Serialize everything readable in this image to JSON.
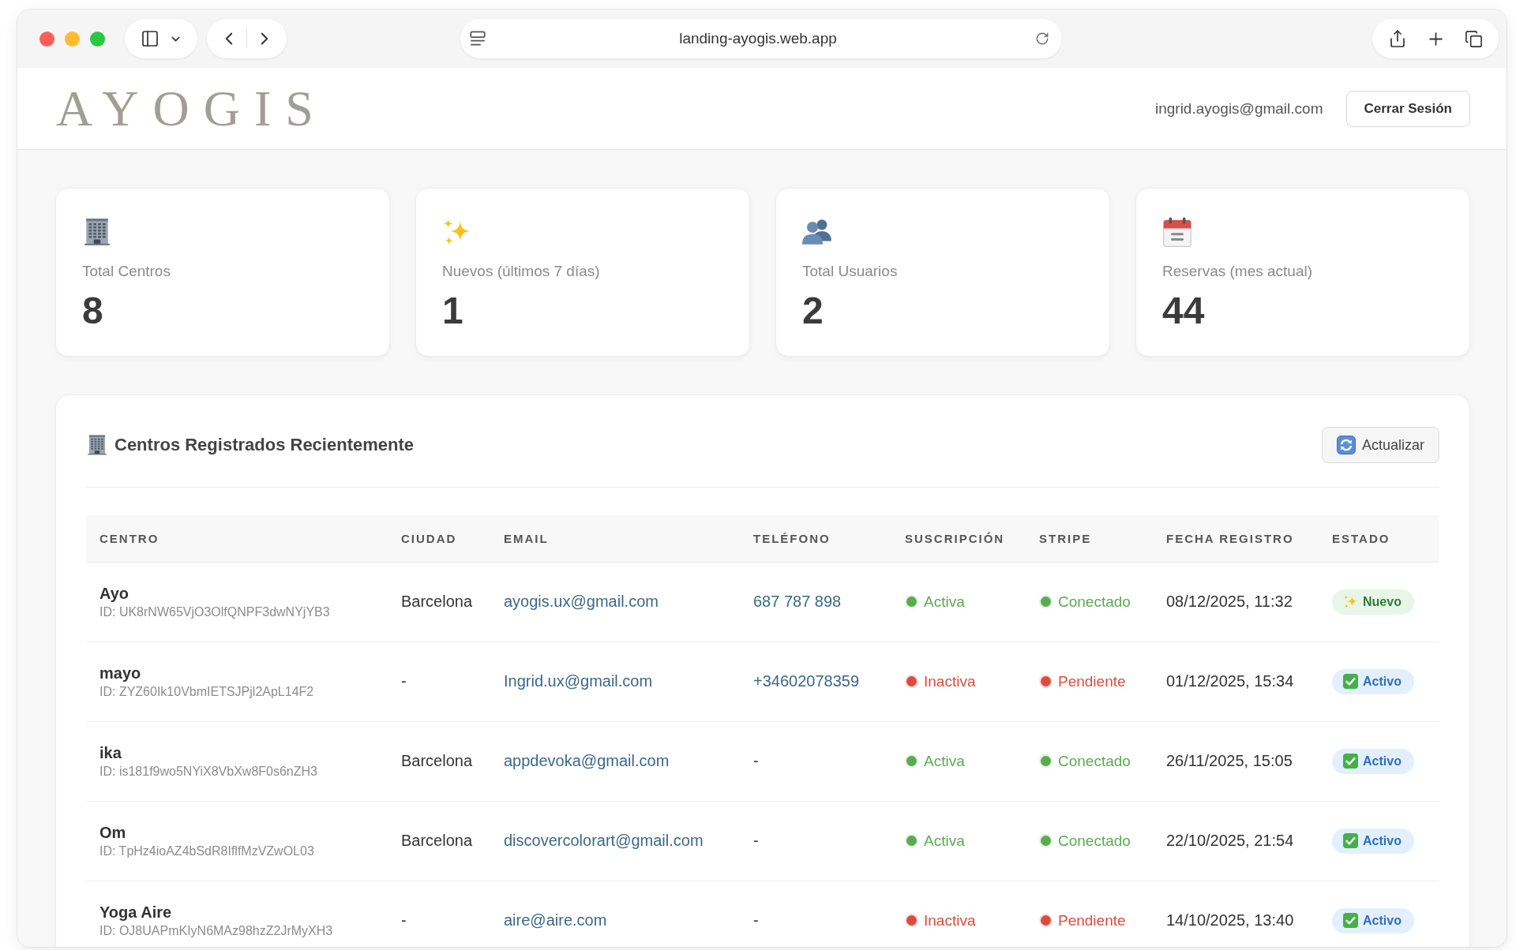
{
  "browser": {
    "url": "landing-ayogis.web.app"
  },
  "header": {
    "logo": "AYOGIS",
    "user_email": "ingrid.ayogis@gmail.com",
    "logout_button": "Cerrar Sesión"
  },
  "stats": [
    {
      "kind": "building",
      "label": "Total Centros",
      "value": "8"
    },
    {
      "kind": "sparkles",
      "label": "Nuevos (últimos 7 días)",
      "value": "1"
    },
    {
      "kind": "users",
      "label": "Total Usuarios",
      "value": "2"
    },
    {
      "kind": "calendar",
      "label": "Reservas (mes actual)",
      "value": "44"
    }
  ],
  "recent_centers": {
    "title": "Centros Registrados Recientemente",
    "refresh_button": "Actualizar",
    "table": {
      "columns": [
        "CENTRO",
        "CIUDAD",
        "EMAIL",
        "TELÉFONO",
        "SUSCRIPCIÓN",
        "STRIPE",
        "FECHA REGISTRO",
        "ESTADO"
      ],
      "rows": [
        {
          "name": "Ayo",
          "id": "ID: UK8rNW65VjO3OlfQNPF3dwNYjYB3",
          "city": "Barcelona",
          "email": "ayogis.ux@gmail.com",
          "phone": {
            "text": "687 787 898",
            "link": true
          },
          "subscription": {
            "label": "Activa",
            "color": "#5aab50"
          },
          "stripe": {
            "label": "Conectado",
            "color": "#5aab50"
          },
          "registered": "08/12/2025, 11:32",
          "status": {
            "label": "Nuevo",
            "kind": "new"
          }
        },
        {
          "name": "mayo",
          "id": "ID: ZYZ60Ik10VbmIETSJPjl2ApL14F2",
          "city": "-",
          "email": "Ingrid.ux@gmail.com",
          "phone": {
            "text": "+34602078359",
            "link": true
          },
          "subscription": {
            "label": "Inactiva",
            "color": "#de4b3c"
          },
          "stripe": {
            "label": "Pendiente",
            "color": "#de4b3c"
          },
          "registered": "01/12/2025, 15:34",
          "status": {
            "label": "Activo",
            "kind": "active"
          }
        },
        {
          "name": "ika",
          "id": "ID: is181f9wo5NYiX8VbXw8F0s6nZH3",
          "city": "Barcelona",
          "email": "appdevoka@gmail.com",
          "phone": {
            "text": "-",
            "link": false
          },
          "subscription": {
            "label": "Activa",
            "color": "#5aab50"
          },
          "stripe": {
            "label": "Conectado",
            "color": "#5aab50"
          },
          "registered": "26/11/2025, 15:05",
          "status": {
            "label": "Activo",
            "kind": "active"
          }
        },
        {
          "name": "Om",
          "id": "ID: TpHz4ioAZ4bSdR8IflfMzVZwOL03",
          "city": "Barcelona",
          "email": "discovercolorart@gmail.com",
          "phone": {
            "text": "-",
            "link": false
          },
          "subscription": {
            "label": "Activa",
            "color": "#5aab50"
          },
          "stripe": {
            "label": "Conectado",
            "color": "#5aab50"
          },
          "registered": "22/10/2025, 21:54",
          "status": {
            "label": "Activo",
            "kind": "active"
          }
        },
        {
          "name": "Yoga Aire",
          "id": "ID: OJ8UAPmKIyN6MAz98hzZ2JrMyXH3",
          "city": "-",
          "email": "aire@aire.com",
          "phone": {
            "text": "-",
            "link": false
          },
          "subscription": {
            "label": "Inactiva",
            "color": "#de4b3c"
          },
          "stripe": {
            "label": "Pendiente",
            "color": "#de4b3c"
          },
          "registered": "14/10/2025, 13:40",
          "status": {
            "label": "Activo",
            "kind": "active"
          }
        }
      ]
    }
  }
}
